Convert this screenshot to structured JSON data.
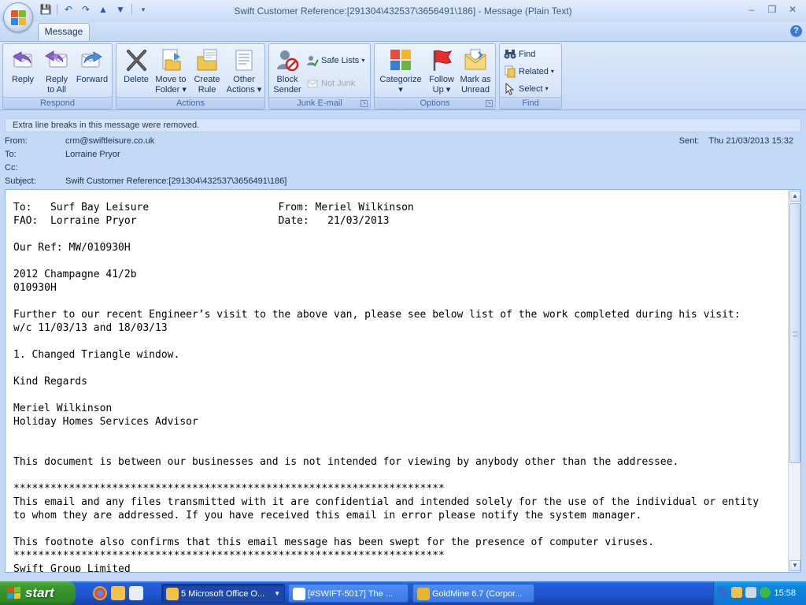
{
  "window": {
    "title": "Swift Customer Reference:[291304\\432537\\3656491\\186] - Message (Plain Text)"
  },
  "ribbon": {
    "tab": "Message",
    "groups": {
      "respond": {
        "label": "Respond",
        "reply": "Reply",
        "reply_all_1": "Reply",
        "reply_all_2": "to All",
        "forward": "Forward"
      },
      "actions": {
        "label": "Actions",
        "delete": "Delete",
        "move_1": "Move to",
        "move_2": "Folder",
        "create_rule_1": "Create",
        "create_rule_2": "Rule",
        "other_1": "Other",
        "other_2": "Actions"
      },
      "junk": {
        "label": "Junk E-mail",
        "block_1": "Block",
        "block_2": "Sender",
        "safe_lists": "Safe Lists",
        "not_junk": "Not Junk"
      },
      "options": {
        "label": "Options",
        "categorize": "Categorize",
        "follow_1": "Follow",
        "follow_2": "Up",
        "mark_1": "Mark as",
        "mark_2": "Unread"
      },
      "find": {
        "label": "Find",
        "find": "Find",
        "related": "Related",
        "select": "Select"
      }
    }
  },
  "infobar": {
    "text": "Extra line breaks in this message were removed."
  },
  "header": {
    "from_label": "From:",
    "from": "crm@swiftleisure.co.uk",
    "to_label": "To:",
    "to": "Lorraine Pryor",
    "cc_label": "Cc:",
    "cc": "",
    "subject_label": "Subject:",
    "subject": "Swift Customer Reference:[291304\\432537\\3656491\\186]",
    "sent_label": "Sent:",
    "sent": "Thu 21/03/2013 15:32"
  },
  "body": {
    "lines": [
      "To:   Surf Bay Leisure                     From: Meriel Wilkinson",
      "FAO:  Lorraine Pryor                       Date:   21/03/2013",
      "",
      "Our Ref: MW/010930H",
      "",
      "2012 Champagne 41/2b",
      "010930H",
      "",
      "Further to our recent Engineer’s visit to the above van, please see below list of the work completed during his visit:",
      "w/c 11/03/13 and 18/03/13",
      "",
      "1. Changed Triangle window.",
      "",
      "Kind Regards",
      "",
      "Meriel Wilkinson",
      "Holiday Homes Services Advisor",
      "",
      "",
      "This document is between our businesses and is not intended for viewing by anybody other than the addressee.",
      "",
      "**********************************************************************",
      "This email and any files transmitted with it are confidential and intended solely for the use of the individual or entity",
      "to whom they are addressed. If you have received this email in error please notify the system manager.",
      "",
      "This footnote also confirms that this email message has been swept for the presence of computer viruses.",
      "**********************************************************************",
      "Swift Group Limited"
    ]
  },
  "taskbar": {
    "start": "start",
    "tasks": [
      "5 Microsoft Office O...",
      "[#SWIFT-5017] The ...",
      "GoldMine 6.7 (Corpor..."
    ],
    "clock": "15:58"
  }
}
